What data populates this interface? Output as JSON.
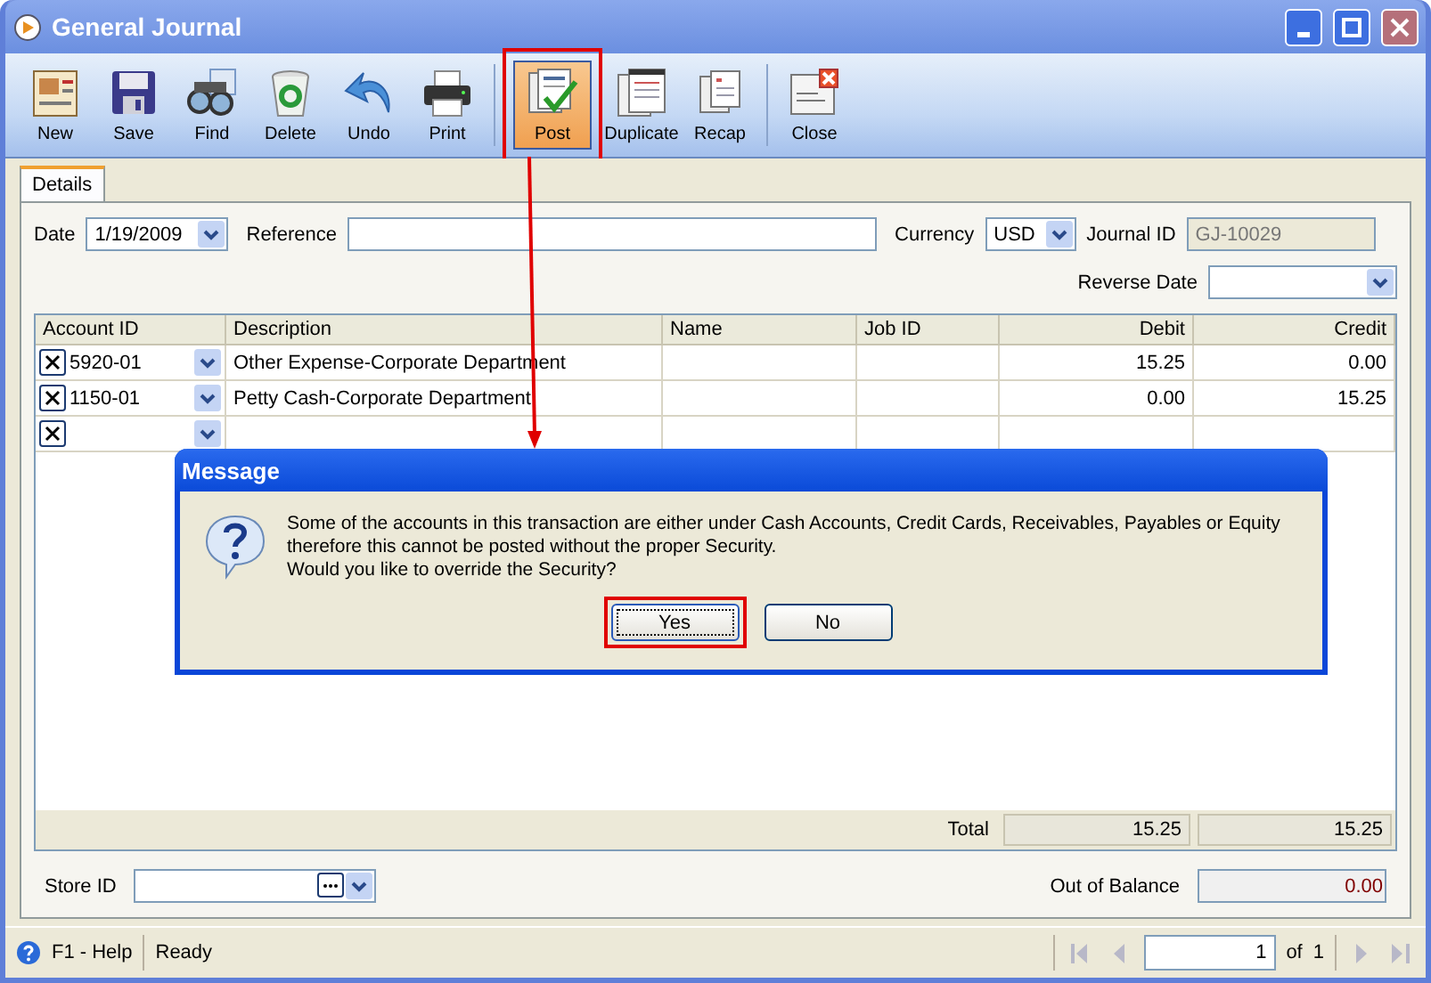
{
  "window": {
    "title": "General Journal"
  },
  "toolbar": [
    {
      "kind": "new",
      "label": "New",
      "highlighted": false,
      "separator_before": false
    },
    {
      "kind": "save",
      "label": "Save",
      "highlighted": false,
      "separator_before": false
    },
    {
      "kind": "find",
      "label": "Find",
      "highlighted": false,
      "separator_before": false
    },
    {
      "kind": "delete",
      "label": "Delete",
      "highlighted": false,
      "separator_before": false
    },
    {
      "kind": "undo",
      "label": "Undo",
      "highlighted": false,
      "separator_before": false
    },
    {
      "kind": "print",
      "label": "Print",
      "highlighted": false,
      "separator_before": false
    },
    {
      "kind": "post",
      "label": "Post",
      "highlighted": true,
      "separator_before": true
    },
    {
      "kind": "duplicate",
      "label": "Duplicate",
      "highlighted": false,
      "separator_before": false
    },
    {
      "kind": "recap",
      "label": "Recap",
      "highlighted": false,
      "separator_before": false
    },
    {
      "kind": "close",
      "label": "Close",
      "highlighted": false,
      "separator_before": true
    }
  ],
  "tabs": [
    {
      "label": "Details",
      "selected": true
    }
  ],
  "form": {
    "date": {
      "label": "Date",
      "value": "1/19/2009"
    },
    "reference": {
      "label": "Reference"
    },
    "currency": {
      "label": "Currency",
      "value": "USD"
    },
    "journal_id": {
      "label": "Journal ID",
      "value": "GJ-10029",
      "disabled": true
    },
    "reverse_date": {
      "label": "Reverse Date"
    }
  },
  "grid": {
    "columns": [
      {
        "label": "Account ID",
        "kind": "text"
      },
      {
        "label": "Description",
        "kind": "text"
      },
      {
        "label": "Name",
        "kind": "text"
      },
      {
        "label": "Job ID",
        "kind": "text"
      },
      {
        "label": "Debit",
        "kind": "amount"
      },
      {
        "label": "Credit",
        "kind": "amount"
      }
    ],
    "rows": [
      {
        "cells": [
          "5920-01",
          "Other Expense-Corporate Department",
          "",
          "",
          "15.25",
          "0.00"
        ]
      },
      {
        "cells": [
          "1150-01",
          "Petty Cash-Corporate Department",
          "",
          "",
          "0.00",
          "15.25"
        ]
      },
      {
        "cells": [
          "",
          "",
          "",
          "",
          "",
          ""
        ]
      }
    ],
    "total": {
      "label": "Total",
      "debit": "15.25",
      "credit": "15.25"
    }
  },
  "footer": {
    "store_id": {
      "label": "Store ID"
    },
    "out_of_balance": {
      "label": "Out of Balance",
      "value": "0.00"
    }
  },
  "status_bar": {
    "help": "F1 - Help",
    "status": "Ready",
    "page": "1",
    "of_label": "of",
    "page_count": "1"
  },
  "dialog": {
    "title": "Message",
    "lines": [
      "Some of the accounts in this transaction are either under Cash Accounts, Credit Cards, Receivables, Payables or Equity",
      "therefore this cannot be posted without the proper Security.",
      "Would you like to override the Security?"
    ],
    "buttons": [
      {
        "label": "Yes",
        "default": true,
        "highlighted": true
      },
      {
        "label": "No",
        "default": false,
        "highlighted": false
      }
    ]
  }
}
